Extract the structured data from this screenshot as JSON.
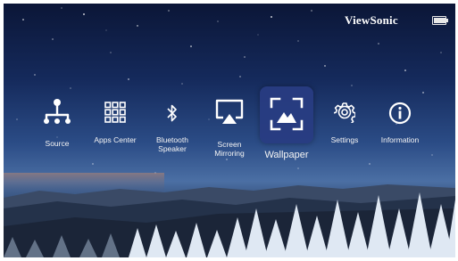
{
  "header": {
    "brand": "ViewSonic",
    "battery_icon": "battery-icon",
    "battery_level": 0.9
  },
  "menu": {
    "selected": "Wallpaper",
    "items": [
      {
        "label": "Source",
        "icon": "source-tree-icon"
      },
      {
        "label": "Apps Center",
        "icon": "apps-grid-icon"
      },
      {
        "label_line1": "Bluetooth",
        "label_line2": "Speaker",
        "icon": "bluetooth-icon"
      },
      {
        "label_line1": "Screen",
        "label_line2": "Mirroring",
        "icon": "screen-mirroring-icon"
      },
      {
        "label": "Wallpaper",
        "icon": "wallpaper-icon"
      },
      {
        "label": "Settings",
        "icon": "gear-icon"
      },
      {
        "label": "Information",
        "icon": "info-icon"
      }
    ]
  },
  "colors": {
    "selected_tile": "#283c82",
    "text": "#ffffff"
  }
}
